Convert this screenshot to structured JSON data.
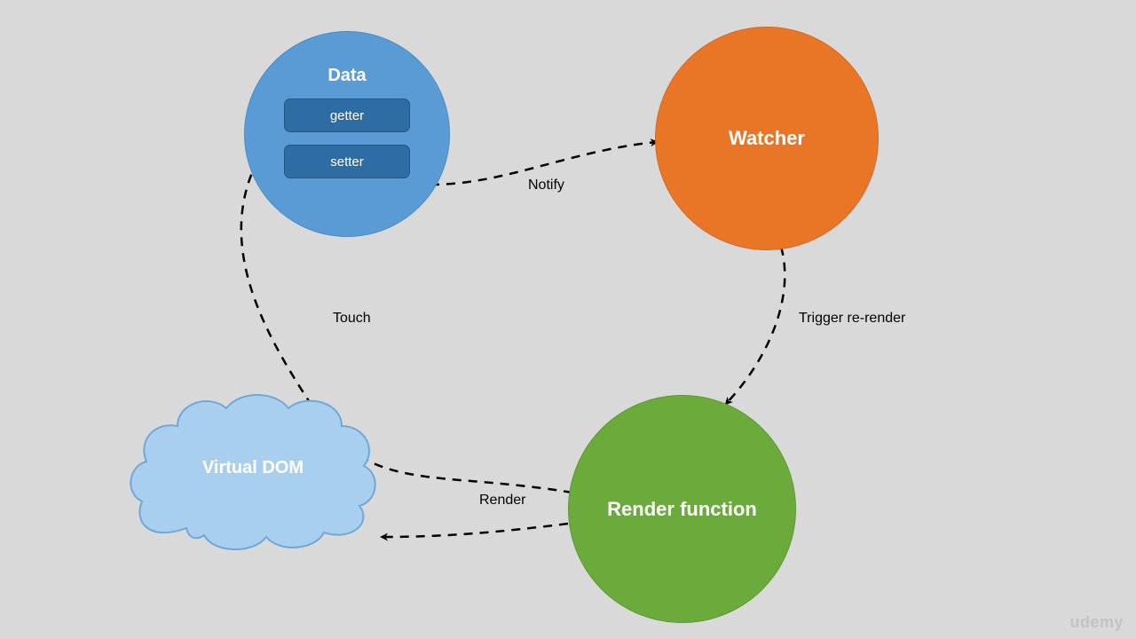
{
  "nodes": {
    "data": {
      "title": "Data",
      "getter": "getter",
      "setter": "setter"
    },
    "watcher": {
      "title": "Watcher"
    },
    "render": {
      "title": "Render function"
    },
    "vdom": {
      "title": "Virtual DOM"
    }
  },
  "edges": {
    "notify": "Notify",
    "trigger": "Trigger re-render",
    "render": "Render",
    "touch": "Touch"
  },
  "watermark": "udemy"
}
